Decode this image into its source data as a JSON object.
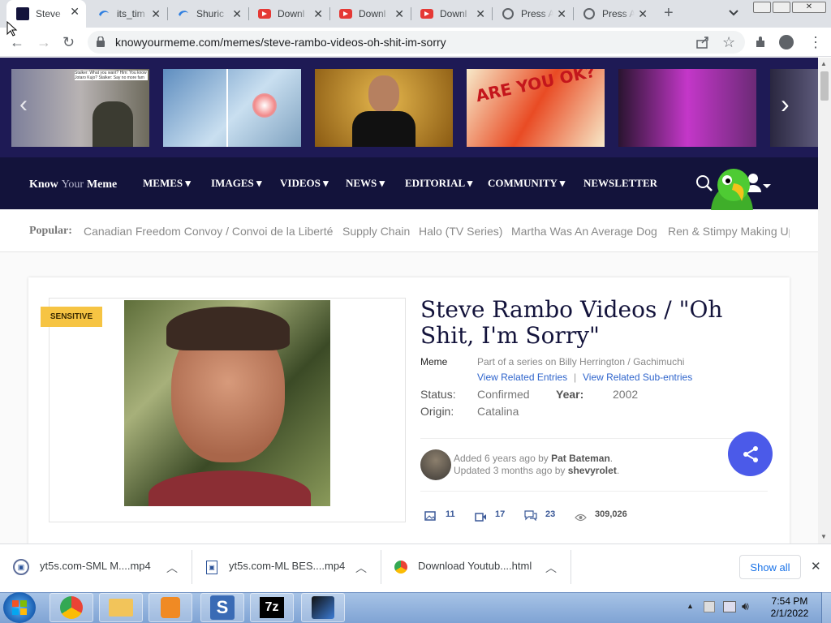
{
  "browser": {
    "tabs": [
      {
        "title": "Steve",
        "favicon": "kym-icon",
        "active": true
      },
      {
        "title": "its_tim",
        "favicon": "shuriken-icon",
        "active": false
      },
      {
        "title": "Shuric",
        "favicon": "shuriken-icon",
        "active": false
      },
      {
        "title": "Downl",
        "favicon": "youtube-icon",
        "active": false
      },
      {
        "title": "Downl",
        "favicon": "youtube-icon",
        "active": false
      },
      {
        "title": "Downl",
        "favicon": "youtube-icon",
        "active": false
      },
      {
        "title": "Press A",
        "favicon": "globe-icon",
        "active": false
      },
      {
        "title": "Press A",
        "favicon": "globe-icon",
        "active": false
      }
    ],
    "new_tab": "+",
    "url": "knowyourmeme.com/memes/steve-rambo-videos-oh-shit-im-sorry"
  },
  "carousel": {
    "thumb_1_caption": "Stalker: What you want? Him: You know Jotaro Kujo? Stalker: Say no more fam"
  },
  "nav": {
    "logo_know": "Know",
    "logo_your": "Your",
    "logo_meme": "Meme",
    "items": [
      "MEMES",
      "IMAGES",
      "VIDEOS",
      "NEWS",
      "EDITORIAL",
      "COMMUNITY",
      "NEWSLETTER"
    ]
  },
  "popular": {
    "label": "Popular:",
    "items": [
      "Canadian Freedom Convoy / Convoi de la Liberté",
      "Supply Chain",
      "Halo (TV Series)",
      "Martha Was An Average Dog",
      "Ren & Stimpy Making Up"
    ]
  },
  "entry": {
    "badge": "SENSITIVE",
    "title": "Steve Rambo Videos / \"Oh Shit, I'm Sorry\"",
    "type": "Meme",
    "series": "Part of a series on Billy Herrington / Gachimuchi",
    "related_entries": "View Related Entries",
    "link_separator": "|",
    "related_subentries": "View Related Sub-entries",
    "status_label": "Status:",
    "status_value": "Confirmed",
    "year_label": "Year:",
    "year_value": "2002",
    "origin_label": "Origin:",
    "origin_value": "Catalina",
    "added_prefix": "Added 6 years ago by",
    "added_by": "Pat Bateman",
    "updated_prefix": "Updated 3 months ago by",
    "updated_by": "shevyrolet",
    "stats": {
      "images": "11",
      "videos": "17",
      "comments": "23",
      "views": "309,026"
    }
  },
  "downloads": {
    "items": [
      "yt5s.com-SML M....mp4",
      "yt5s.com-ML BES....mp4",
      "Download Youtub....html"
    ],
    "show_all": "Show all"
  },
  "taskbar": {
    "time": "7:54 PM",
    "date": "2/1/2022",
    "app_7z_label": "7z"
  },
  "colors": {
    "nav_bg": "#13133b",
    "carousel_bg": "#1e1a55",
    "link": "#2e64cc",
    "badge": "#f6c443",
    "share": "#4b5ae9"
  }
}
